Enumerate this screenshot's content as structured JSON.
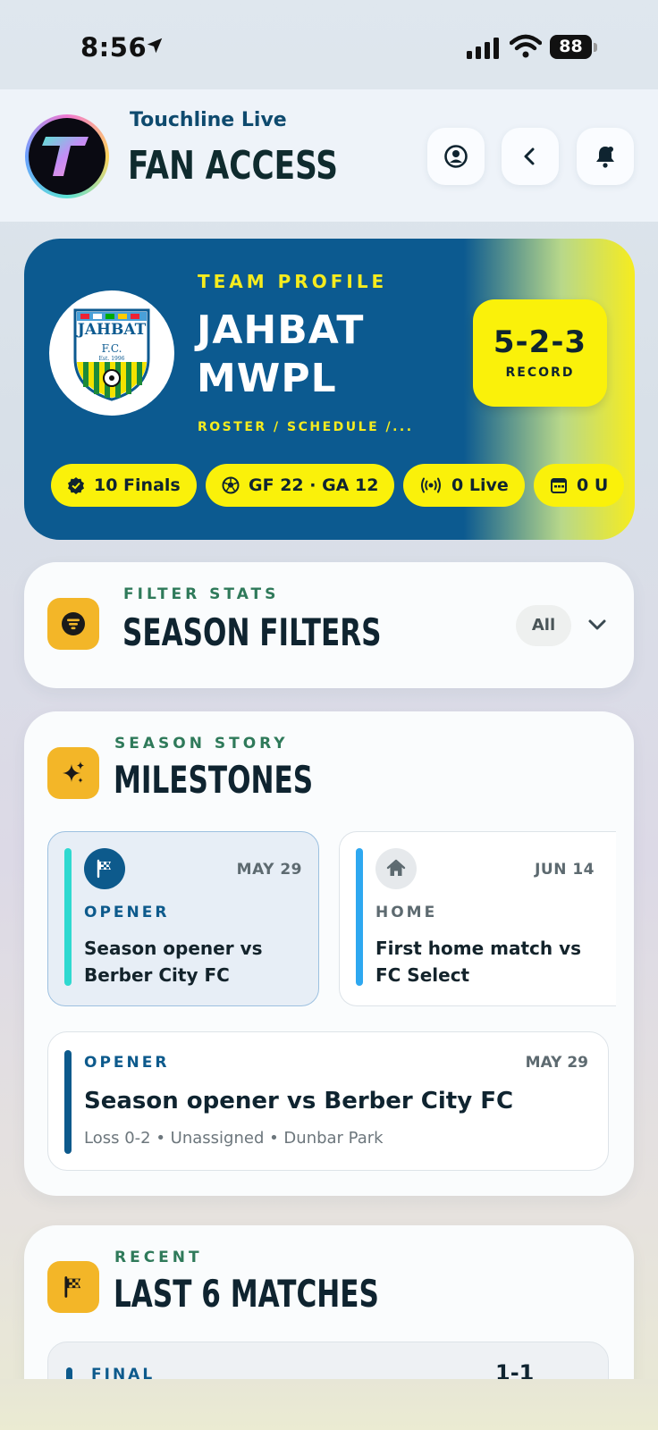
{
  "status_bar": {
    "time": "8:56",
    "battery": "88"
  },
  "header": {
    "app_name": "Touchline Live",
    "title": "FAN ACCESS"
  },
  "team": {
    "kicker": "TEAM PROFILE",
    "name_line1": "JAHBAT",
    "name_line2": "MWPL",
    "links": "ROSTER  /  SCHEDULE  /...",
    "crest_text": "JAHBAT",
    "crest_sub": "F.C.",
    "crest_est": "Est. 1996",
    "record_value": "5-2-3",
    "record_label": "RECORD",
    "chips": [
      "10 Finals",
      "GF 22 · GA 12",
      "0 Live",
      "0 U"
    ]
  },
  "filters": {
    "kicker": "FILTER STATS",
    "title": "SEASON FILTERS",
    "selected": "All"
  },
  "milestones": {
    "kicker": "SEASON STORY",
    "title": "MILESTONES",
    "tiles": [
      {
        "date": "MAY 29",
        "category": "OPENER",
        "description": "Season opener vs Berber City FC",
        "accent": "#2fd9d0"
      },
      {
        "date": "JUN 14",
        "category": "HOME",
        "description": "First home match vs FC Select",
        "accent": "#2ea8f0"
      }
    ],
    "detail": {
      "category": "OPENER",
      "date": "MAY 29",
      "title": "Season opener vs Berber City FC",
      "meta": "Loss 0-2 • Unassigned • Dunbar Park"
    }
  },
  "recent": {
    "kicker": "RECENT",
    "title": "LAST 6 MATCHES",
    "first_row": {
      "status": "FINAL",
      "score": "1-1"
    }
  },
  "colors": {
    "brand_blue": "#0c5a90",
    "brand_yellow": "#faf10a",
    "accent_orange": "#f3b628",
    "kicker_green": "#2f7a5a"
  }
}
